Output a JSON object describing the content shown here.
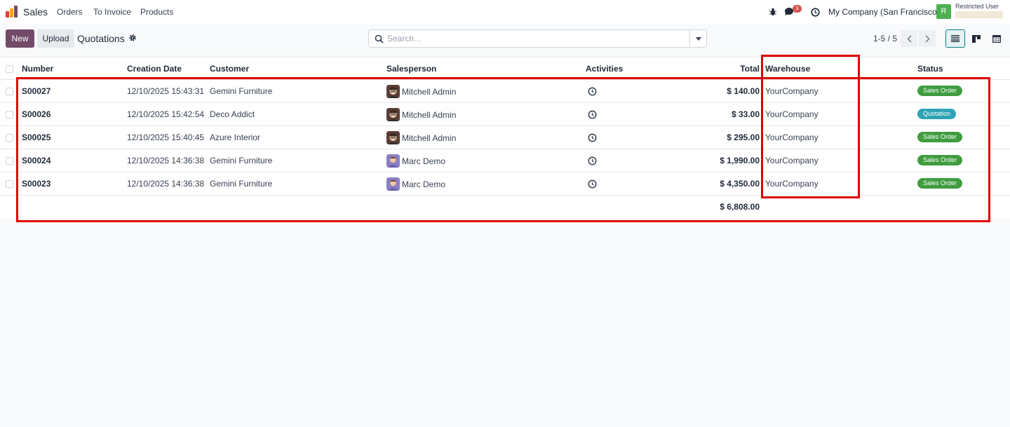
{
  "navbar": {
    "app_name": "Sales",
    "menus": [
      "Orders",
      "To Invoice",
      "Products"
    ],
    "message_count": "3",
    "company": "My Company (San Francisco)",
    "user_initial": "R",
    "user_name": "Restricted User"
  },
  "control_panel": {
    "new_label": "New",
    "upload_label": "Upload",
    "title": "Quotations",
    "search_placeholder": "Search...",
    "pager": "1-5 / 5"
  },
  "table": {
    "headers": {
      "number": "Number",
      "creation_date": "Creation Date",
      "customer": "Customer",
      "salesperson": "Salesperson",
      "activities": "Activities",
      "total": "Total",
      "warehouse": "Warehouse",
      "status": "Status"
    },
    "rows": [
      {
        "number": "S00027",
        "date": "12/10/2025 15:43:31",
        "customer": "Gemini Furniture",
        "salesperson": "Mitchell Admin",
        "total": "$ 140.00",
        "warehouse": "YourCompany",
        "status": "Sales Order"
      },
      {
        "number": "S00026",
        "date": "12/10/2025 15:42:54",
        "customer": "Deco Addict",
        "salesperson": "Mitchell Admin",
        "total": "$ 33.00",
        "warehouse": "YourCompany",
        "status": "Quotation"
      },
      {
        "number": "S00025",
        "date": "12/10/2025 15:40:45",
        "customer": "Azure Interior",
        "salesperson": "Mitchell Admin",
        "total": "$ 295.00",
        "warehouse": "YourCompany",
        "status": "Sales Order"
      },
      {
        "number": "S00024",
        "date": "12/10/2025 14:36:38",
        "customer": "Gemini Furniture",
        "salesperson": "Marc Demo",
        "total": "$ 1,990.00",
        "warehouse": "YourCompany",
        "status": "Sales Order"
      },
      {
        "number": "S00023",
        "date": "12/10/2025 14:36:38",
        "customer": "Gemini Furniture",
        "salesperson": "Marc Demo",
        "total": "$ 4,350.00",
        "warehouse": "YourCompany",
        "status": "Sales Order"
      }
    ],
    "grand_total": "$ 6,808.00"
  },
  "colors": {
    "brand": "#714b67",
    "sales_order": "#3f9c3f",
    "quotation": "#2ea3b3",
    "highlight": "#e00000"
  }
}
